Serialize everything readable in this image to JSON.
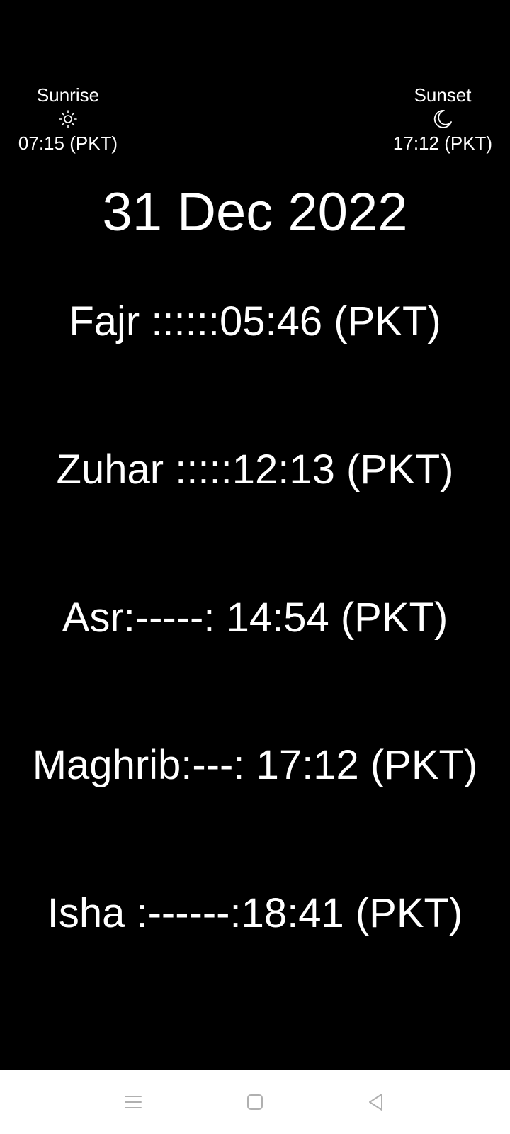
{
  "sunrise": {
    "label": "Sunrise",
    "icon": "sun-icon",
    "time": "07:15 (PKT)"
  },
  "sunset": {
    "label": "Sunset",
    "icon": "moon-icon",
    "time": "17:12 (PKT)"
  },
  "date": "31 Dec 2022",
  "prayers": [
    {
      "text": "Fajr ::::::05:46 (PKT)"
    },
    {
      "text": "Zuhar :::::12:13 (PKT)"
    },
    {
      "text": "Asr:-----: 14:54 (PKT)"
    },
    {
      "text": "Maghrib:---: 17:12 (PKT)"
    },
    {
      "text": "Isha :------:18:41 (PKT)"
    }
  ],
  "navbar": {
    "buttons": [
      "menu-icon",
      "home-square-icon",
      "back-triangle-icon"
    ]
  },
  "colors": {
    "background": "#000000",
    "text": "#ffffff",
    "navbar_background": "#ffffff",
    "nav_icon": "#b0b0b0"
  }
}
